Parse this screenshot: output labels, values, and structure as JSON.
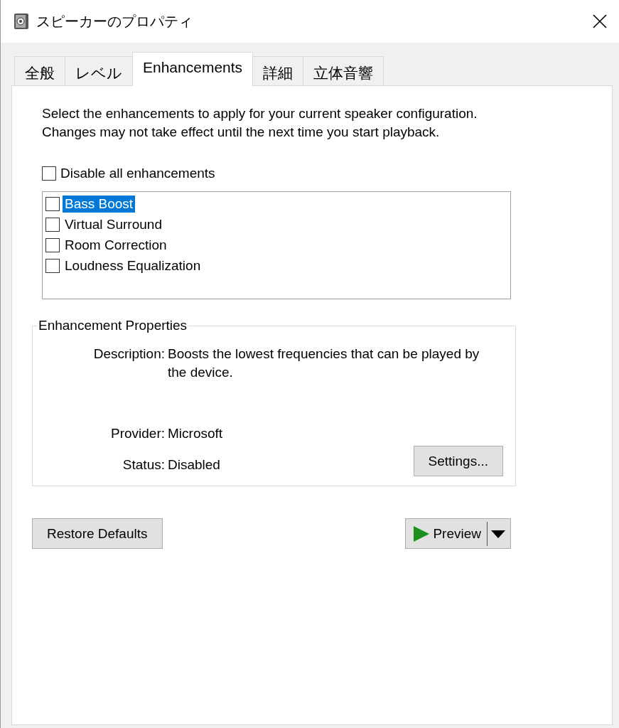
{
  "window": {
    "title": "スピーカーのプロパティ"
  },
  "tabs": [
    {
      "label": "全般",
      "selected": false
    },
    {
      "label": "レベル",
      "selected": false
    },
    {
      "label": "Enhancements",
      "selected": true
    },
    {
      "label": "詳細",
      "selected": false
    },
    {
      "label": "立体音響",
      "selected": false
    }
  ],
  "intro": "Select the enhancements to apply for your current speaker configuration. Changes may not take effect until the next time you start playback.",
  "disable_all": {
    "label": "Disable all enhancements",
    "checked": false
  },
  "enhancements": [
    {
      "label": "Bass Boost",
      "checked": false,
      "selected": true
    },
    {
      "label": "Virtual Surround",
      "checked": false,
      "selected": false
    },
    {
      "label": "Room Correction",
      "checked": false,
      "selected": false
    },
    {
      "label": "Loudness Equalization",
      "checked": false,
      "selected": false
    }
  ],
  "properties": {
    "title": "Enhancement Properties",
    "rows": [
      {
        "label": "Description:",
        "value": "Boosts the lowest frequencies that can be played by the device."
      },
      {
        "label": "Provider:",
        "value": "Microsoft"
      },
      {
        "label": "Status:",
        "value": "Disabled"
      }
    ],
    "settings_button": "Settings..."
  },
  "buttons": {
    "restore": "Restore Defaults",
    "preview": "Preview"
  }
}
